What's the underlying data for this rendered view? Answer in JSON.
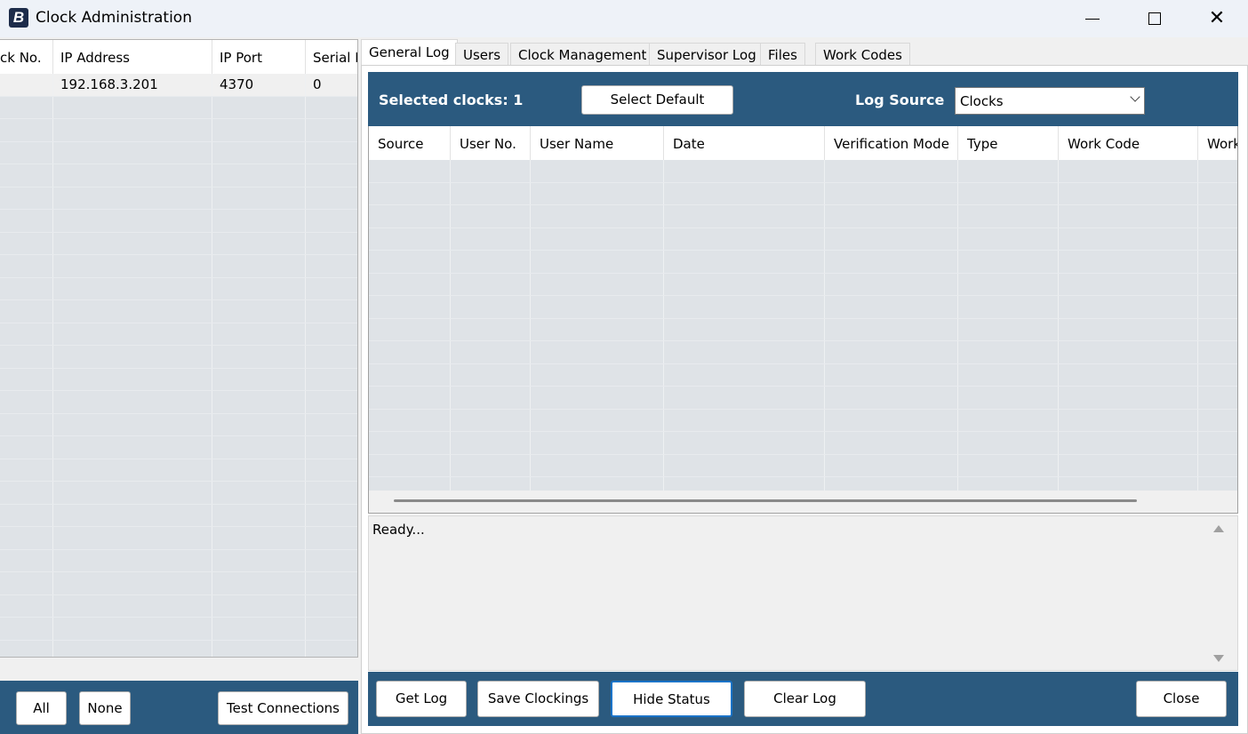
{
  "window": {
    "title": "Clock Administration",
    "icon_label": "B"
  },
  "clock_grid": {
    "columns": [
      "ck No.",
      "IP Address",
      "IP Port",
      "Serial P"
    ],
    "rows": [
      [
        "",
        "192.168.3.201",
        "4370",
        "0"
      ]
    ]
  },
  "left_footer": {
    "all_label": "All",
    "none_label": "None",
    "test_label": "Test Connections"
  },
  "tabs": [
    {
      "label": "General Log",
      "active": true
    },
    {
      "label": "Users",
      "active": false
    },
    {
      "label": "Clock Management",
      "active": false
    },
    {
      "label": "Supervisor Log",
      "active": false
    },
    {
      "label": "Files",
      "active": false
    },
    {
      "label": "Work Codes",
      "active": false
    }
  ],
  "general_log": {
    "selected_clocks": "Selected clocks: 1",
    "select_default_label": "Select Default",
    "log_source_label": "Log Source",
    "log_source_value": "Clocks",
    "columns": [
      "Source",
      "User No.",
      "User Name",
      "Date",
      "Verification Mode",
      "Type",
      "Work Code",
      "Work"
    ],
    "status_text": "Ready..."
  },
  "right_footer": {
    "get_log": "Get Log",
    "save_clockings": "Save Clockings",
    "hide_status": "Hide Status",
    "clear_log": "Clear Log",
    "close": "Close"
  },
  "colors": {
    "accent_blue": "#2b5a7f",
    "empty_row": "#dfe3e7"
  }
}
